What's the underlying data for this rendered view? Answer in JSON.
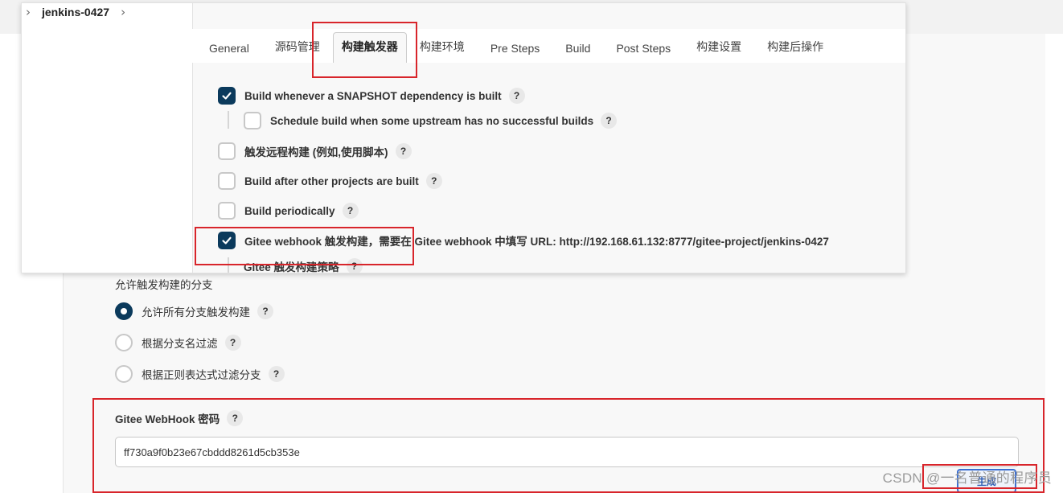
{
  "breadcrumb": {
    "job": "jenkins-0427"
  },
  "tabs": [
    {
      "label": "General"
    },
    {
      "label": "源码管理"
    },
    {
      "label": "构建触发器"
    },
    {
      "label": "构建环境"
    },
    {
      "label": "Pre Steps"
    },
    {
      "label": "Build"
    },
    {
      "label": "Post Steps"
    },
    {
      "label": "构建设置"
    },
    {
      "label": "构建后操作"
    }
  ],
  "active_tab": "构建触发器",
  "triggers": [
    {
      "label": "Build whenever a SNAPSHOT dependency is built",
      "checked": true
    },
    {
      "label": "Schedule build when some upstream has no successful builds",
      "checked": false
    },
    {
      "label": "触发远程构建 (例如,使用脚本)",
      "checked": false
    },
    {
      "label": "Build after other projects are built",
      "checked": false
    },
    {
      "label": "Build periodically",
      "checked": false
    },
    {
      "label": "Gitee webhook 触发构建，需要在 Gitee webhook 中填写 URL: http://192.168.61.132:8777/gitee-project/jenkins-0427",
      "checked": true
    }
  ],
  "strategy_label": "Gitee 触发构建策略",
  "branch_section": {
    "title": "允许触发构建的分支",
    "options": [
      {
        "label": "允许所有分支触发构建",
        "selected": true
      },
      {
        "label": "根据分支名过滤",
        "selected": false
      },
      {
        "label": "根据正则表达式过滤分支",
        "selected": false
      }
    ]
  },
  "webhook_password": {
    "label": "Gitee WebHook 密码",
    "value": "ff730a9f0b23e67cbddd8261d5cb353e",
    "generate_button": "生成"
  },
  "help_glyph": "?",
  "watermark": "CSDN @一名普通的程序员",
  "colors": {
    "checkbox_checked": "#0b3a5c",
    "annotation_red": "#d8252b",
    "panel_bg": "#f8f8f8"
  },
  "icons": {
    "breadcrumb_separator": "chevron-right-icon",
    "check": "check-icon",
    "help": "help-icon"
  }
}
